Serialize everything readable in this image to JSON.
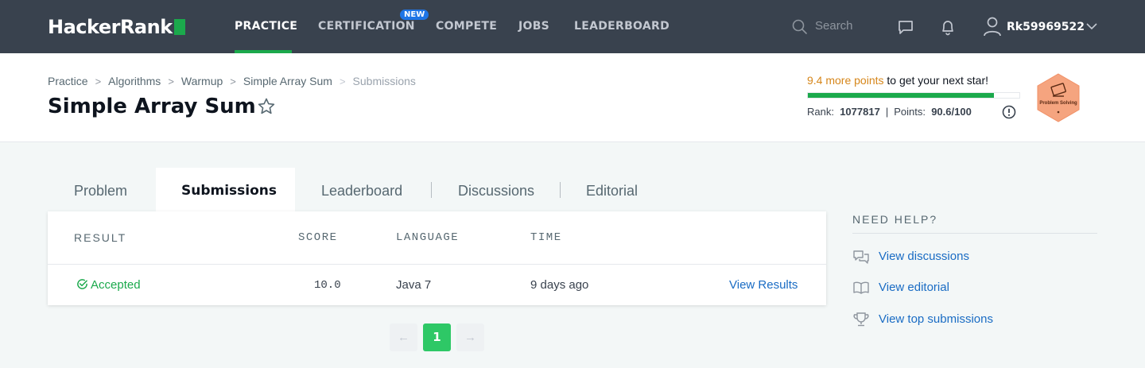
{
  "nav": {
    "logo": "HackerRank",
    "items": [
      "PRACTICE",
      "CERTIFICATION",
      "COMPETE",
      "JOBS",
      "LEADERBOARD"
    ],
    "new_badge": "NEW",
    "search_placeholder": "Search",
    "username": "Rk59969522",
    "icons": [
      "search-icon",
      "message-icon",
      "bell-icon",
      "user-icon",
      "chevron-down-icon"
    ]
  },
  "breadcrumb": [
    "Practice",
    "Algorithms",
    "Warmup",
    "Simple Array Sum",
    "Submissions"
  ],
  "page_title": "Simple Array Sum",
  "progress": {
    "points_highlight": "9.4 more points",
    "points_rest": " to get your next star!",
    "fill_fraction": 0.88,
    "rank_label": "Rank:",
    "rank_value": "1077817",
    "points_label": "Points:",
    "points_value": "90.6/100",
    "badge_label": "Problem Solving",
    "accent": "#1ba94c",
    "badge_color": "#f5a47f"
  },
  "tabs": [
    "Problem",
    "Submissions",
    "Leaderboard",
    "Discussions",
    "Editorial"
  ],
  "active_tab": "Submissions",
  "submissions": {
    "headers": [
      "RESULT",
      "SCORE",
      "LANGUAGE",
      "TIME"
    ],
    "rows": [
      {
        "result": "Accepted",
        "score": "10.0",
        "language": "Java 7",
        "time": "9 days ago",
        "action": "View Results"
      }
    ]
  },
  "pagination": {
    "prev": "←",
    "current": "1",
    "next": "→"
  },
  "help": {
    "title": "NEED HELP?",
    "links": [
      "View discussions",
      "View editorial",
      "View top submissions"
    ]
  }
}
